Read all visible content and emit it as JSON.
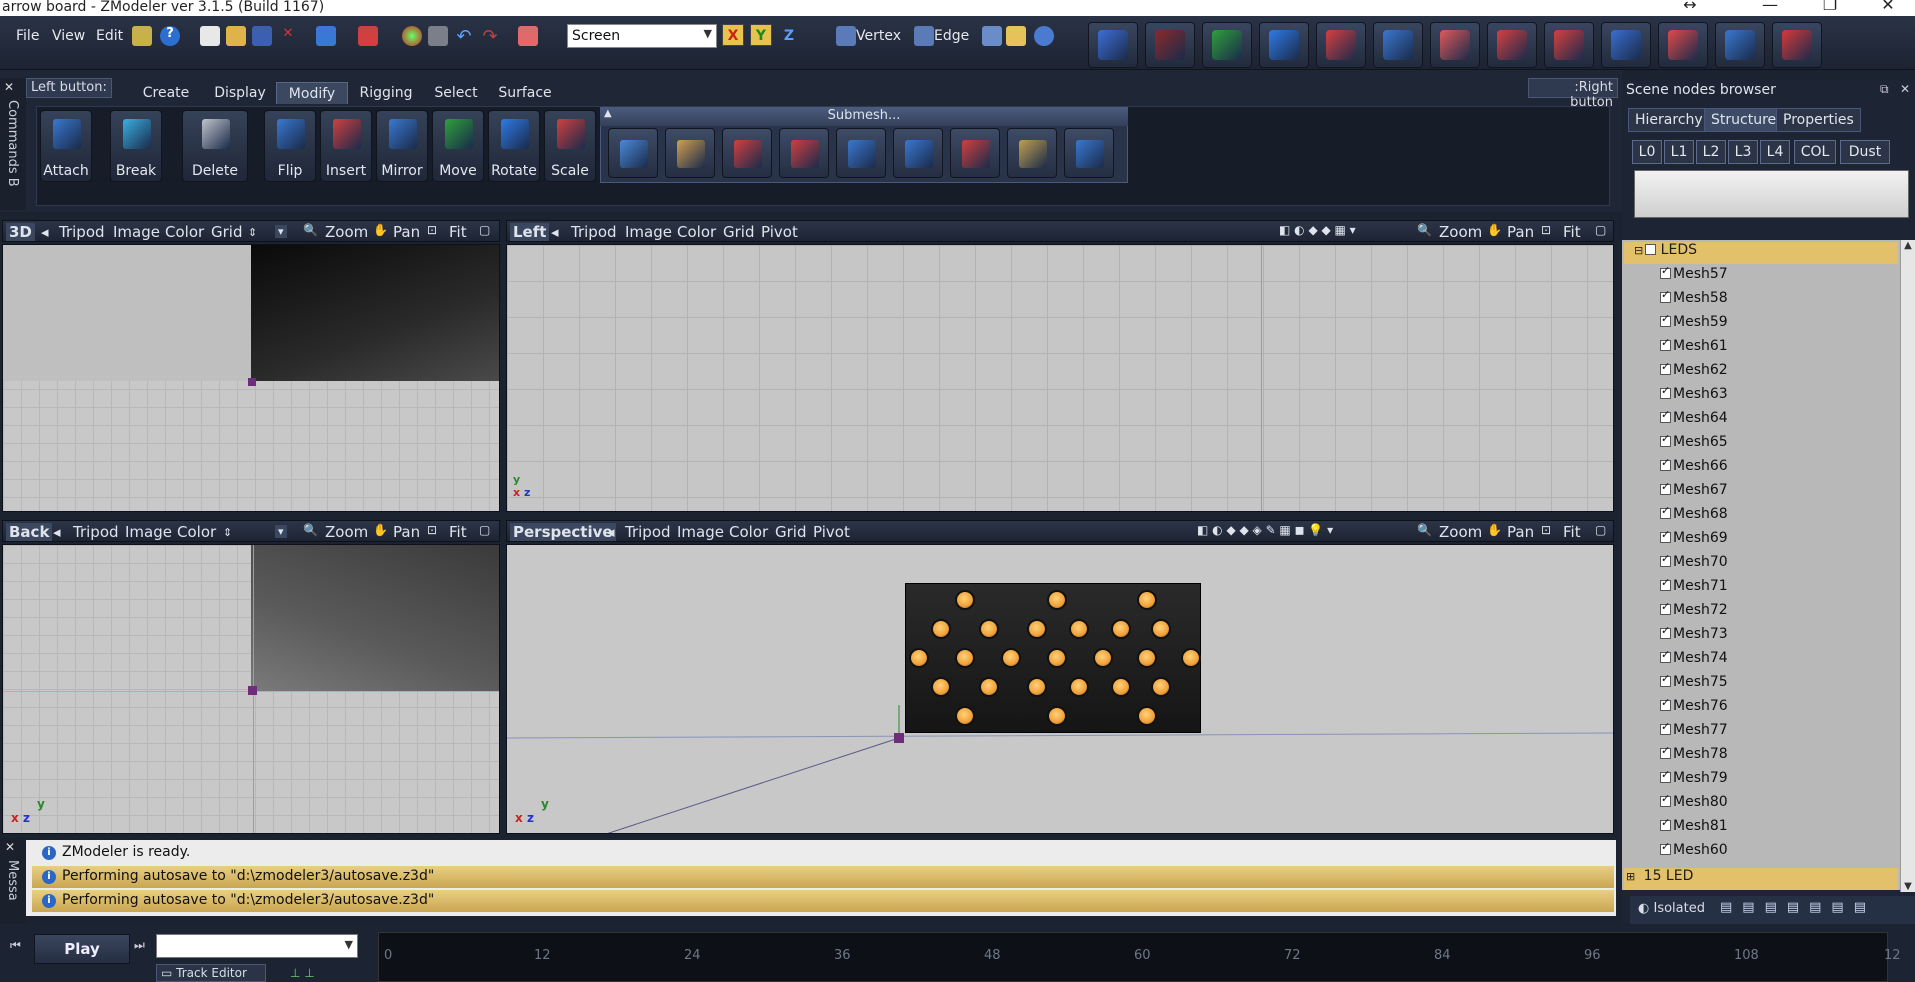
{
  "window": {
    "title": "arrow board - ZModeler ver 3.1.5 (Build 1167)"
  },
  "menu": {
    "items": [
      "File",
      "View",
      "Edit"
    ]
  },
  "toolbar": {
    "screen_select": "Screen",
    "axis_x": "X",
    "axis_y": "Y",
    "axis_z": "Z",
    "vertex_label": "Vertex",
    "edge_label": "Edge",
    "big_buttons": [
      "undo-icon",
      "redo-icon",
      "move-icon",
      "rotate-icon",
      "scale-icon",
      "mirror-icon",
      "attach-icon",
      "insert-icon",
      "split-icon",
      "extrude-icon",
      "cut-icon",
      "cube-icon",
      "sphere-icon"
    ]
  },
  "commands": {
    "left_button_label": "Left button:",
    "right_button_label": ":Right button",
    "side_label": "Commands B",
    "tabs": [
      "Create",
      "Display",
      "Modify",
      "Rigging",
      "Select",
      "Surface"
    ],
    "active_tab": "Modify",
    "modify_buttons": [
      "Attach",
      "Break",
      "Delete",
      "Flip",
      "Insert",
      "Mirror",
      "Move",
      "Rotate",
      "Scale"
    ],
    "submesh_title": "Submesh..."
  },
  "viewports": {
    "v3d": {
      "name": "3D",
      "items": [
        "Tripod",
        "Image",
        "Color",
        "Grid"
      ],
      "zoom": "Zoom",
      "pan": "Pan",
      "fit": "Fit"
    },
    "left": {
      "name": "Left",
      "items": [
        "Tripod",
        "Image",
        "Color",
        "Grid",
        "Pivot"
      ],
      "zoom": "Zoom",
      "pan": "Pan",
      "fit": "Fit"
    },
    "back": {
      "name": "Back",
      "items": [
        "Tripod",
        "Image",
        "Color"
      ],
      "zoom": "Zoom",
      "pan": "Pan",
      "fit": "Fit"
    },
    "perspective": {
      "name": "Perspective",
      "items": [
        "Tripod",
        "Image",
        "Color",
        "Grid",
        "Pivot"
      ],
      "zoom": "Zoom",
      "pan": "Pan",
      "fit": "Fit"
    }
  },
  "scene": {
    "title": "Scene nodes browser",
    "tabs": [
      "Hierarchy",
      "Structure",
      "Properties"
    ],
    "active_tab": "Structure",
    "lods": [
      "L0",
      "L1",
      "L2",
      "L3",
      "L4",
      "COL",
      "Dust"
    ],
    "group_open": "LEDS",
    "meshes": [
      "Mesh57",
      "Mesh58",
      "Mesh59",
      "Mesh61",
      "Mesh62",
      "Mesh63",
      "Mesh64",
      "Mesh65",
      "Mesh66",
      "Mesh67",
      "Mesh68",
      "Mesh69",
      "Mesh70",
      "Mesh71",
      "Mesh72",
      "Mesh73",
      "Mesh74",
      "Mesh75",
      "Mesh76",
      "Mesh77",
      "Mesh78",
      "Mesh79",
      "Mesh80",
      "Mesh81",
      "Mesh60"
    ],
    "group_closed": "15 LED",
    "isolated_label": "Isolated"
  },
  "messages": {
    "side_label": "Messa",
    "rows": [
      "ZModeler is ready.",
      "Performing autosave to \"d:\\zmodeler3/autosave.z3d\"",
      "Performing autosave to \"d:\\zmodeler3/autosave.z3d\""
    ]
  },
  "timeline": {
    "play_label": "Play",
    "track_editor_label": "Track Editor",
    "ticks": [
      "0",
      "12",
      "24",
      "36",
      "48",
      "60",
      "72",
      "84",
      "96",
      "108",
      "12"
    ]
  },
  "colors": {
    "led": "#f0a13a",
    "panel": "#1f2635",
    "highlight": "#e3c06a"
  }
}
